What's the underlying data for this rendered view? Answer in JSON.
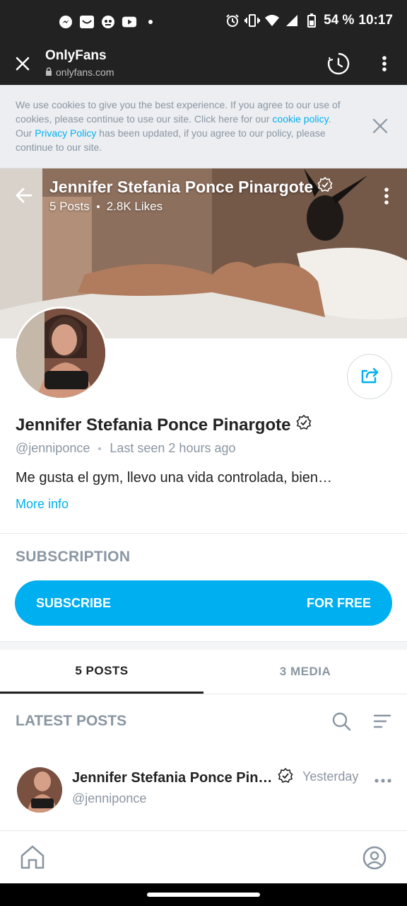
{
  "status_bar": {
    "battery": "54 %",
    "time": "10:17",
    "left_icons": [
      "messenger-icon",
      "inbox-icon",
      "game-icon",
      "youtube-icon",
      "dot-icon"
    ],
    "right_icons": [
      "alarm-icon",
      "vibrate-icon",
      "wifi-icon",
      "signal-icon",
      "battery-icon"
    ]
  },
  "browser": {
    "title": "OnlyFans",
    "url": "onlyfans.com"
  },
  "cookie": {
    "text_1": "We use cookies to give you the best experience. If you agree to our use of cookies, please continue to use our site. Click here for our ",
    "link_cookie": "cookie policy",
    "text_2": ". Our ",
    "link_privacy": "Privacy Policy",
    "text_3": " has been updated, if you agree to our policy, please continue to our site."
  },
  "cover": {
    "name": "Jennifer Stefania Ponce Pinargote",
    "posts": "5 Posts",
    "likes": "2.8K Likes"
  },
  "profile": {
    "name": "Jennifer Stefania Ponce Pinargote",
    "handle": "@jenniponce",
    "last_seen": "Last seen 2 hours ago",
    "bio": "Me gusta el gym, llevo una vida controlada, bien…",
    "more_info": "More info"
  },
  "subscription": {
    "title": "SUBSCRIPTION",
    "button_left": "SUBSCRIBE",
    "button_right": "FOR FREE"
  },
  "tabs": [
    {
      "label": "5 POSTS",
      "active": true
    },
    {
      "label": "3 MEDIA",
      "active": false
    }
  ],
  "latest": {
    "title": "LATEST POSTS"
  },
  "post": {
    "author": "Jennifer Stefania Ponce Pin…",
    "handle": "@jenniponce",
    "time": "Yesterday"
  },
  "colors": {
    "accent": "#00aff0",
    "muted": "#8a96a3",
    "dark_bar": "#222222"
  }
}
